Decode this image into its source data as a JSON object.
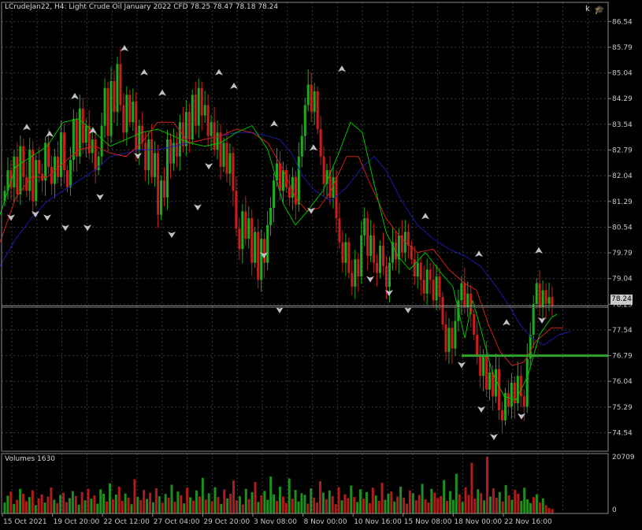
{
  "header": {
    "symbol": "LCrudeJan22, H4:",
    "description": "Light Crude Oil January 2022 CFD",
    "ohlc": "78.25 78.47 78.18 78.24"
  },
  "volume_panel": {
    "title": "Volumes 1630"
  },
  "toolbar": {
    "k_label": "k",
    "cap_icon": "graduation-cap-icon"
  },
  "current_price_label": "78.24",
  "colors": {
    "background": "#000000",
    "grid": "#3a3a3a",
    "bull": "#1faa1f",
    "bear": "#c81e1e",
    "ma_fast": "#00c000",
    "ma_mid": "#d02020",
    "ma_slow": "#1a1aa8",
    "support_line": "#2ea32e",
    "volume_bull": "#1f8f1f",
    "volume_bear": "#b01c1c",
    "fractal": "#c0c0c8"
  },
  "chart_data": {
    "type": "candlestick",
    "y_ticks": [
      "86.54",
      "85.79",
      "85.04",
      "84.29",
      "83.54",
      "82.79",
      "82.04",
      "81.29",
      "80.54",
      "79.79",
      "79.04",
      "78.29",
      "77.54",
      "76.79",
      "76.04",
      "75.29",
      "74.54"
    ],
    "y_range": [
      74.0,
      86.8
    ],
    "x_ticks": [
      "15 Oct 2021",
      "19 Oct 20:00",
      "22 Oct 12:00",
      "27 Oct 04:00",
      "29 Oct 20:00",
      "3 Nov 08:00",
      "8 Nov 00:00",
      "10 Nov 16:00",
      "15 Nov 08:00",
      "18 Nov 00:00",
      "22 Nov 16:00"
    ],
    "current_price": 78.24,
    "support_level": 76.79,
    "volume_axis": [
      "20709",
      "0"
    ],
    "volume_max": 20709,
    "closes": [
      81.6,
      82.2,
      81.7,
      82.6,
      81.5,
      82.9,
      82.0,
      81.6,
      82.8,
      81.3,
      82.5,
      82.1,
      81.9,
      83.0,
      82.3,
      81.8,
      82.6,
      82.0,
      83.3,
      82.2,
      81.7,
      82.5,
      83.7,
      82.6,
      84.0,
      83.0,
      83.5,
      82.7,
      83.1,
      82.2,
      82.6,
      83.5,
      84.6,
      83.2,
      84.8,
      83.9,
      85.3,
      84.1,
      83.3,
      84.4,
      83.6,
      84.2,
      82.8,
      83.5,
      83.0,
      82.2,
      83.1,
      82.0,
      82.7,
      80.9,
      81.9,
      81.4,
      83.1,
      82.4,
      83.0,
      82.6,
      83.6,
      82.9,
      83.9,
      83.1,
      84.4,
      83.5,
      84.6,
      83.8,
      84.1,
      83.2,
      83.6,
      82.8,
      83.3,
      82.3,
      83.0,
      82.1,
      82.7,
      81.6,
      80.5,
      79.9,
      81.0,
      80.2,
      80.8,
      79.5,
      80.4,
      79.0,
      80.2,
      79.5,
      80.6,
      81.1,
      81.9,
      82.4,
      81.6,
      82.2,
      81.7,
      81.4,
      82.0,
      81.2,
      82.6,
      83.2,
      84.1,
      84.7,
      83.9,
      84.5,
      83.4,
      82.6,
      81.8,
      82.2,
      81.4,
      82.0,
      80.8,
      80.1,
      79.5,
      80.1,
      79.2,
      78.8,
      79.6,
      79.1,
      80.3,
      80.8,
      79.7,
      80.3,
      79.5,
      79.2,
      80.0,
      79.4,
      78.8,
      79.5,
      80.1,
      79.6,
      80.3,
      79.8,
      80.4,
      80.0,
      79.6,
      79.1,
      79.5,
      79.0,
      78.6,
      79.3,
      79.0,
      78.4,
      79.1,
      78.5,
      77.7,
      76.9,
      77.6,
      77.0,
      77.8,
      78.4,
      78.9,
      78.2,
      78.6,
      78.0,
      77.4,
      76.8,
      76.2,
      76.8,
      75.8,
      76.3,
      75.6,
      76.4,
      75.2,
      74.9,
      75.7,
      75.3,
      76.0,
      75.4,
      76.2,
      75.6,
      75.3,
      76.7,
      77.4,
      78.3,
      78.9,
      78.2,
      78.7,
      78.3,
      78.5,
      78.24
    ],
    "volumes": [
      4000,
      6500,
      8000,
      3500,
      5000,
      9000,
      7200,
      4500,
      6000,
      8500,
      3000,
      5500,
      7000,
      4000,
      6200,
      9500,
      5000,
      3800,
      6800,
      7500,
      4200,
      5600,
      8200,
      6400,
      3200,
      7800,
      4800,
      9000,
      5400,
      6600,
      3600,
      8800,
      7200,
      4400,
      11000,
      5200,
      6900,
      9800,
      4600,
      7300,
      5800,
      3400,
      12500,
      6100,
      4900,
      8600,
      5300,
      7600,
      4100,
      9200,
      6300,
      3900,
      7100,
      5700,
      10500,
      4300,
      8000,
      6700,
      3700,
      9400,
      5900,
      4700,
      8400,
      6200,
      13000,
      5100,
      7400,
      4500,
      9600,
      6000,
      3500,
      8800,
      5500,
      7200,
      12000,
      4800,
      6400,
      3300,
      9000,
      5200,
      7800,
      11500,
      4200,
      6600,
      8200,
      5000,
      13500,
      7000,
      4600,
      9800,
      6200,
      3800,
      12800,
      5400,
      8600,
      4400,
      7400,
      6800,
      3600,
      9200,
      5800,
      4000,
      11800,
      7600,
      5200,
      8400,
      6400,
      3400,
      9600,
      4800,
      7000,
      5600,
      10200,
      6000,
      4200,
      8800,
      5400,
      7800,
      3800,
      9400,
      6600,
      4600,
      11200,
      5000,
      7200,
      8000,
      4400,
      6200,
      9800,
      5800,
      3600,
      8400,
      7400,
      4800,
      6800,
      10800,
      5200,
      4000,
      9000,
      7600,
      5600,
      6400,
      12200,
      4600,
      8200,
      5000,
      14500,
      7000,
      4200,
      9600,
      6800,
      18500,
      5400,
      8800,
      7400,
      4800,
      20709,
      6200,
      9200,
      5800,
      7800,
      4400,
      10400,
      6600,
      5000,
      8600,
      7200,
      4600,
      9400,
      5200,
      3800,
      6000,
      7000,
      4000,
      5500,
      3000,
      2000,
      1630
    ],
    "ma_fast": [
      [
        0,
        80.9
      ],
      [
        20,
        82.3
      ],
      [
        40,
        82.6
      ],
      [
        60,
        82.9
      ],
      [
        80,
        83.6
      ],
      [
        100,
        83.7
      ],
      [
        120,
        83.3
      ],
      [
        140,
        82.9
      ],
      [
        160,
        83.1
      ],
      [
        180,
        83.3
      ],
      [
        200,
        83.4
      ],
      [
        220,
        83.2
      ],
      [
        240,
        83.0
      ],
      [
        260,
        82.9
      ],
      [
        280,
        83.0
      ],
      [
        300,
        83.3
      ],
      [
        320,
        83.5
      ],
      [
        340,
        82.8
      ],
      [
        360,
        81.2
      ],
      [
        375,
        80.6
      ],
      [
        390,
        81.0
      ],
      [
        410,
        81.6
      ],
      [
        430,
        82.7
      ],
      [
        445,
        83.6
      ],
      [
        460,
        83.3
      ],
      [
        475,
        81.8
      ],
      [
        490,
        80.4
      ],
      [
        505,
        79.7
      ],
      [
        520,
        79.3
      ],
      [
        540,
        79.8
      ],
      [
        560,
        79.2
      ],
      [
        575,
        78.8
      ],
      [
        590,
        77.3
      ],
      [
        600,
        78.4
      ],
      [
        610,
        77.6
      ],
      [
        625,
        76.3
      ],
      [
        640,
        75.6
      ],
      [
        655,
        75.5
      ],
      [
        670,
        76.2
      ],
      [
        685,
        77.4
      ],
      [
        700,
        77.9
      ],
      [
        707,
        78.0
      ]
    ],
    "ma_mid": [
      [
        0,
        80.1
      ],
      [
        20,
        81.4
      ],
      [
        40,
        82.0
      ],
      [
        60,
        82.0
      ],
      [
        80,
        82.4
      ],
      [
        100,
        82.8
      ],
      [
        120,
        82.9
      ],
      [
        140,
        82.7
      ],
      [
        160,
        82.6
      ],
      [
        180,
        83.0
      ],
      [
        200,
        83.6
      ],
      [
        220,
        83.6
      ],
      [
        240,
        83.0
      ],
      [
        260,
        83.1
      ],
      [
        280,
        83.2
      ],
      [
        300,
        83.4
      ],
      [
        320,
        83.3
      ],
      [
        340,
        83.0
      ],
      [
        360,
        82.2
      ],
      [
        375,
        81.4
      ],
      [
        390,
        81.0
      ],
      [
        405,
        81.1
      ],
      [
        420,
        81.6
      ],
      [
        440,
        82.6
      ],
      [
        455,
        82.6
      ],
      [
        470,
        81.8
      ],
      [
        490,
        80.8
      ],
      [
        510,
        80.2
      ],
      [
        530,
        79.8
      ],
      [
        550,
        79.9
      ],
      [
        570,
        79.3
      ],
      [
        590,
        78.9
      ],
      [
        605,
        78.7
      ],
      [
        620,
        77.7
      ],
      [
        635,
        76.9
      ],
      [
        650,
        76.5
      ],
      [
        665,
        76.6
      ],
      [
        680,
        77.2
      ],
      [
        700,
        77.6
      ],
      [
        715,
        77.6
      ]
    ],
    "ma_slow": [
      [
        0,
        79.4
      ],
      [
        20,
        80.2
      ],
      [
        40,
        80.8
      ],
      [
        60,
        81.3
      ],
      [
        80,
        81.6
      ],
      [
        100,
        81.9
      ],
      [
        120,
        82.2
      ],
      [
        140,
        82.6
      ],
      [
        160,
        82.7
      ],
      [
        180,
        82.8
      ],
      [
        200,
        82.8
      ],
      [
        220,
        82.9
      ],
      [
        240,
        83.0
      ],
      [
        260,
        83.1
      ],
      [
        280,
        83.2
      ],
      [
        300,
        83.3
      ],
      [
        320,
        83.3
      ],
      [
        340,
        83.2
      ],
      [
        355,
        83.1
      ],
      [
        370,
        82.7
      ],
      [
        385,
        82.0
      ],
      [
        400,
        81.6
      ],
      [
        420,
        81.3
      ],
      [
        440,
        81.7
      ],
      [
        460,
        82.3
      ],
      [
        475,
        82.6
      ],
      [
        490,
        82.2
      ],
      [
        510,
        81.3
      ],
      [
        530,
        80.6
      ],
      [
        550,
        80.2
      ],
      [
        570,
        79.9
      ],
      [
        590,
        79.7
      ],
      [
        610,
        79.4
      ],
      [
        630,
        78.8
      ],
      [
        645,
        78.3
      ],
      [
        660,
        77.7
      ],
      [
        675,
        77.3
      ],
      [
        690,
        77.1
      ],
      [
        710,
        77.4
      ],
      [
        725,
        77.5
      ]
    ],
    "fractals_up": [
      [
        34,
        83.44
      ],
      [
        63,
        83.24
      ],
      [
        95,
        84.34
      ],
      [
        118,
        83.34
      ],
      [
        158,
        85.74
      ],
      [
        183,
        85.04
      ],
      [
        206,
        84.44
      ],
      [
        278,
        85.04
      ],
      [
        297,
        84.64
      ],
      [
        348,
        83.54
      ],
      [
        398,
        82.84
      ],
      [
        434,
        85.14
      ],
      [
        540,
        80.84
      ],
      [
        608,
        79.74
      ],
      [
        643,
        77.74
      ],
      [
        684,
        79.84
      ]
    ],
    "fractals_down": [
      [
        14,
        80.84
      ],
      [
        45,
        80.94
      ],
      [
        60,
        80.84
      ],
      [
        83,
        80.54
      ],
      [
        111,
        80.54
      ],
      [
        127,
        81.44
      ],
      [
        175,
        82.64
      ],
      [
        218,
        80.34
      ],
      [
        251,
        81.14
      ],
      [
        265,
        82.34
      ],
      [
        335,
        79.74
      ],
      [
        355,
        78.14
      ],
      [
        395,
        81.04
      ],
      [
        470,
        79.04
      ],
      [
        494,
        78.64
      ],
      [
        518,
        78.14
      ],
      [
        586,
        76.54
      ],
      [
        611,
        75.24
      ],
      [
        627,
        74.44
      ],
      [
        662,
        75.04
      ],
      [
        688,
        77.84
      ]
    ]
  }
}
